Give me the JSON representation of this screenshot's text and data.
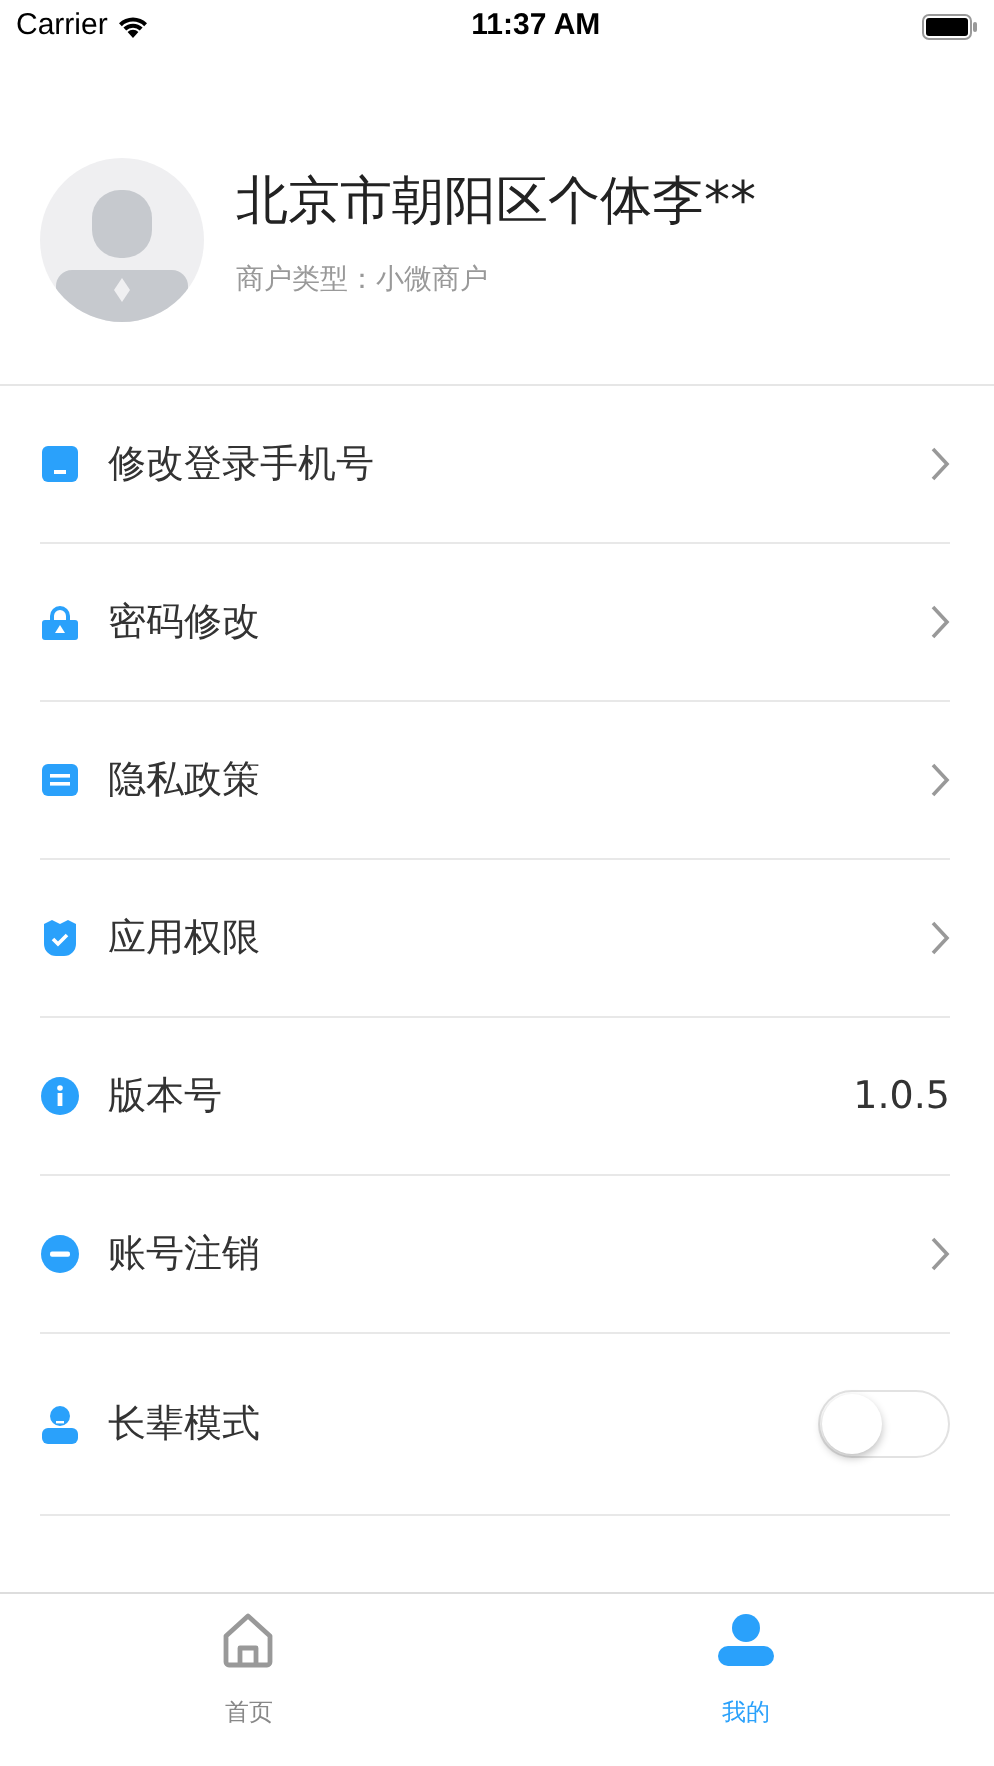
{
  "status_bar": {
    "carrier": "Carrier",
    "time": "11:37 AM"
  },
  "profile": {
    "name": "北京市朝阳区个体李**",
    "merchant_type": "商户类型：小微商户"
  },
  "menu": [
    {
      "kind": "link",
      "label": "修改登录手机号"
    },
    {
      "kind": "link",
      "label": "密码修改"
    },
    {
      "kind": "link",
      "label": "隐私政策"
    },
    {
      "kind": "link",
      "label": "应用权限"
    },
    {
      "kind": "value",
      "label": "版本号",
      "value": "1.0.5"
    },
    {
      "kind": "link",
      "label": "账号注销"
    },
    {
      "kind": "toggle",
      "label": "长辈模式",
      "on": false
    }
  ],
  "tab_bar": [
    {
      "label": "首页",
      "selected": false
    },
    {
      "label": "我的",
      "selected": true
    }
  ]
}
